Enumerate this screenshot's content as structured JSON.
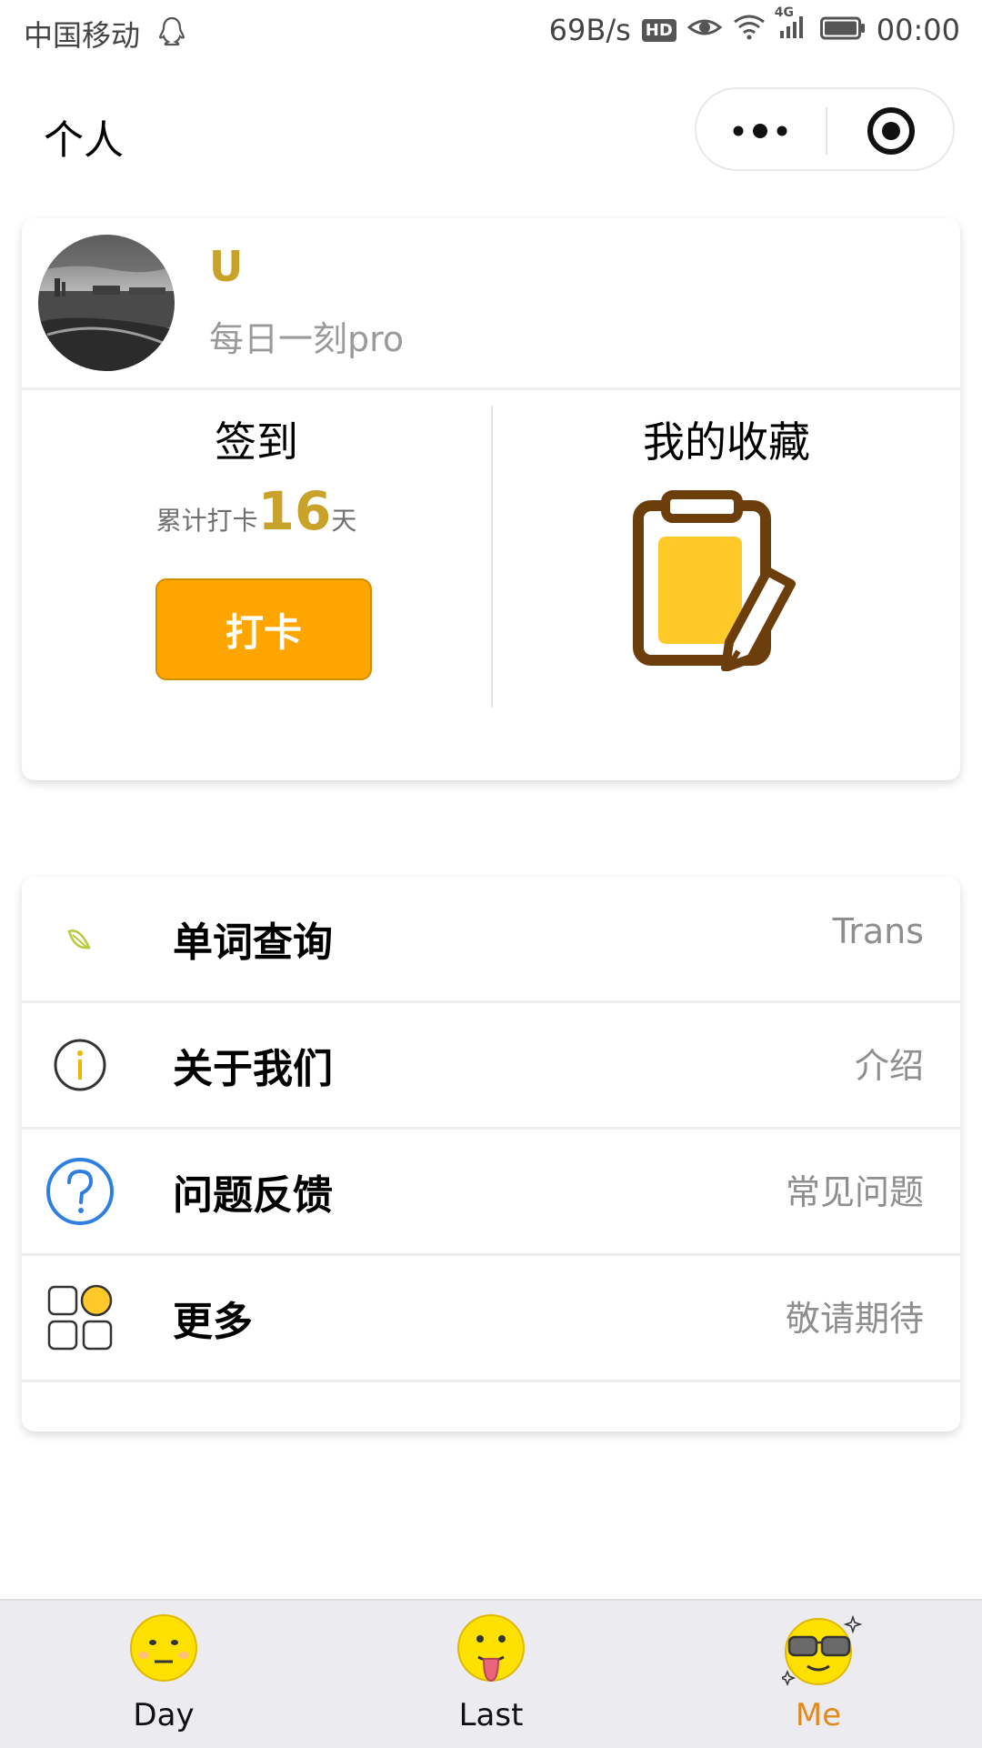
{
  "status_bar": {
    "carrier": "中国移动",
    "network_speed": "69B/s",
    "hd": "HD",
    "network_type": "4G",
    "time": "00:00"
  },
  "nav": {
    "title": "个人"
  },
  "profile": {
    "username": "U",
    "subtitle": "每日一刻pro"
  },
  "checkin": {
    "title": "签到",
    "prefix": "累计打卡",
    "days": "16",
    "suffix": "天",
    "button_label": "打卡"
  },
  "favorites": {
    "title": "我的收藏",
    "icon": "clipboard-pencil-icon"
  },
  "menu": [
    {
      "label": "单词查询",
      "value": "Trans",
      "icon": "leaf-icon"
    },
    {
      "label": "关于我们",
      "value": "介绍",
      "icon": "info-icon"
    },
    {
      "label": "问题反馈",
      "value": "常见问题",
      "icon": "question-icon"
    },
    {
      "label": "更多",
      "value": "敬请期待",
      "icon": "apps-icon"
    }
  ],
  "tabs": [
    {
      "label": "Day",
      "icon": "neutral-face-icon"
    },
    {
      "label": "Last",
      "icon": "tongue-face-icon"
    },
    {
      "label": "Me",
      "icon": "sunglasses-face-icon",
      "active": true
    }
  ],
  "colors": {
    "accent_gold": "#c9a22a",
    "checkin_button": "#ffa500",
    "active_tab": "#e08a1e",
    "clipboard_brown": "#6b3e0c",
    "clipboard_fill": "#ffc928"
  }
}
